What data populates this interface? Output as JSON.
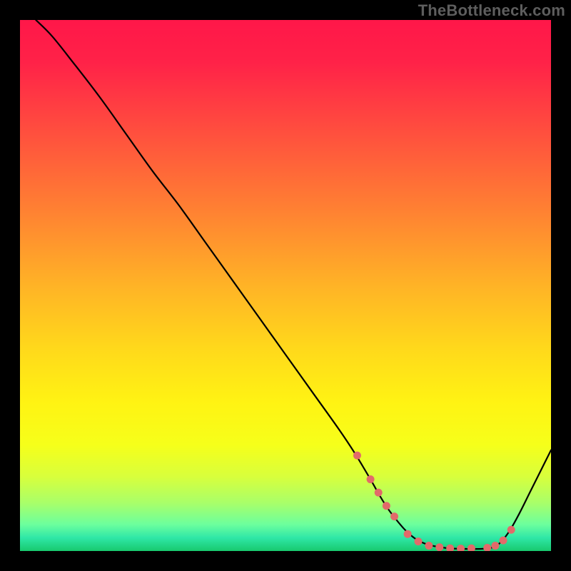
{
  "watermark": "TheBottleneck.com",
  "plot": {
    "x_range": [
      0,
      100
    ],
    "y_range": [
      0,
      100
    ],
    "background_gradient": {
      "stops": [
        {
          "offset": 0.0,
          "color": "#ff1749"
        },
        {
          "offset": 0.08,
          "color": "#ff2248"
        },
        {
          "offset": 0.2,
          "color": "#ff4b3f"
        },
        {
          "offset": 0.35,
          "color": "#ff7e33"
        },
        {
          "offset": 0.5,
          "color": "#ffb326"
        },
        {
          "offset": 0.62,
          "color": "#ffd91b"
        },
        {
          "offset": 0.72,
          "color": "#fff313"
        },
        {
          "offset": 0.8,
          "color": "#f6ff1a"
        },
        {
          "offset": 0.86,
          "color": "#d8ff3c"
        },
        {
          "offset": 0.91,
          "color": "#a8ff6a"
        },
        {
          "offset": 0.95,
          "color": "#6cff9d"
        },
        {
          "offset": 0.975,
          "color": "#2fe7a7"
        },
        {
          "offset": 1.0,
          "color": "#18c96e"
        }
      ]
    }
  },
  "chart_data": {
    "type": "line",
    "title": "",
    "xlabel": "",
    "ylabel": "",
    "xlim": [
      0,
      100
    ],
    "ylim": [
      0,
      100
    ],
    "series": [
      {
        "name": "curve",
        "x": [
          3,
          6,
          10,
          15,
          20,
          25,
          30,
          35,
          40,
          45,
          50,
          55,
          60,
          63,
          66,
          68,
          70,
          73,
          76,
          80,
          84,
          88,
          90,
          92,
          94,
          96,
          98,
          100
        ],
        "y": [
          100,
          97,
          92,
          85.5,
          78.5,
          71.5,
          65,
          58,
          51,
          44,
          37,
          30,
          23,
          18.5,
          13.5,
          10,
          7,
          3.5,
          1.5,
          0.6,
          0.4,
          0.5,
          1.2,
          3.5,
          7,
          11,
          15,
          19
        ]
      }
    ],
    "markers": {
      "name": "dots",
      "color": "#e26a6a",
      "x": [
        63.5,
        66,
        67.5,
        69,
        70.5,
        73,
        75,
        77,
        79,
        81,
        83,
        85,
        88,
        89.5,
        91,
        92.5
      ],
      "y": [
        18,
        13.5,
        11,
        8.5,
        6.5,
        3.2,
        1.8,
        1.0,
        0.7,
        0.5,
        0.45,
        0.5,
        0.6,
        1.0,
        2.0,
        4.0
      ]
    }
  }
}
